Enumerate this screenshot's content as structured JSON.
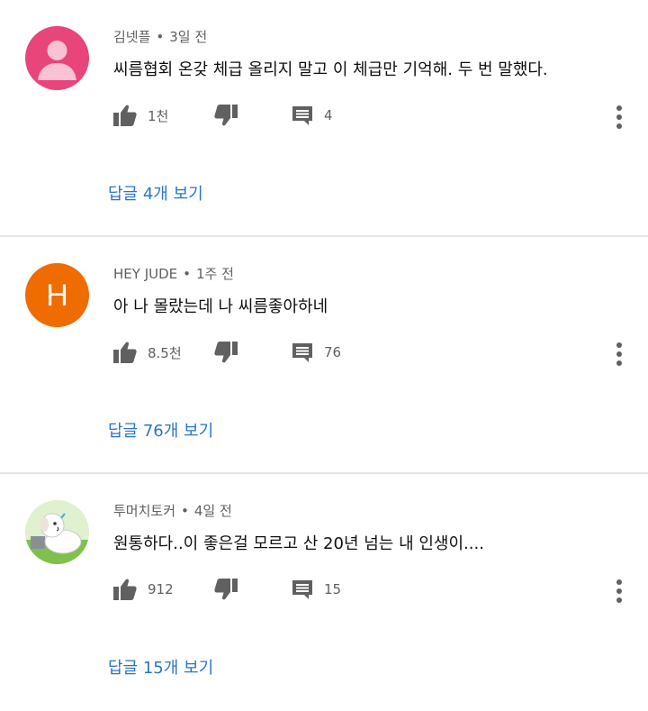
{
  "comments": [
    {
      "author": "김넷플",
      "time": "3일 전",
      "text": "씨름협회 온갖 체급 올리지 말고 이 체급만 기억해. 두 번 말했다.",
      "likes": "1천",
      "reply_count": "4",
      "replies_link": "답글 4개 보기",
      "avatar": {
        "type": "default-person",
        "bg": "#e8457a"
      }
    },
    {
      "author": "HEY JUDE",
      "time": "1주 전",
      "text": "아 나 몰랐는데 나 씨름좋아하네",
      "likes": "8.5천",
      "reply_count": "76",
      "replies_link": "답글 76개 보기",
      "avatar": {
        "type": "letter",
        "letter": "H",
        "bg": "#ef6c00"
      }
    },
    {
      "author": "투머치토커",
      "time": "4일 전",
      "text": "원통하다..이 좋은걸 모르고 산 20년 넘는 내 인생이....",
      "likes": "912",
      "reply_count": "15",
      "replies_link": "답글 15개 보기",
      "avatar": {
        "type": "cartoon-dog",
        "bg": "#7fc14a"
      }
    }
  ],
  "meta_separator": "•",
  "icons": {
    "like": "thumb-up-icon",
    "dislike": "thumb-down-icon",
    "reply": "comment-icon",
    "menu": "more-vert-icon"
  },
  "colors": {
    "link": "#2a75c6",
    "icon": "#606060",
    "divider": "#e5e5e5"
  }
}
